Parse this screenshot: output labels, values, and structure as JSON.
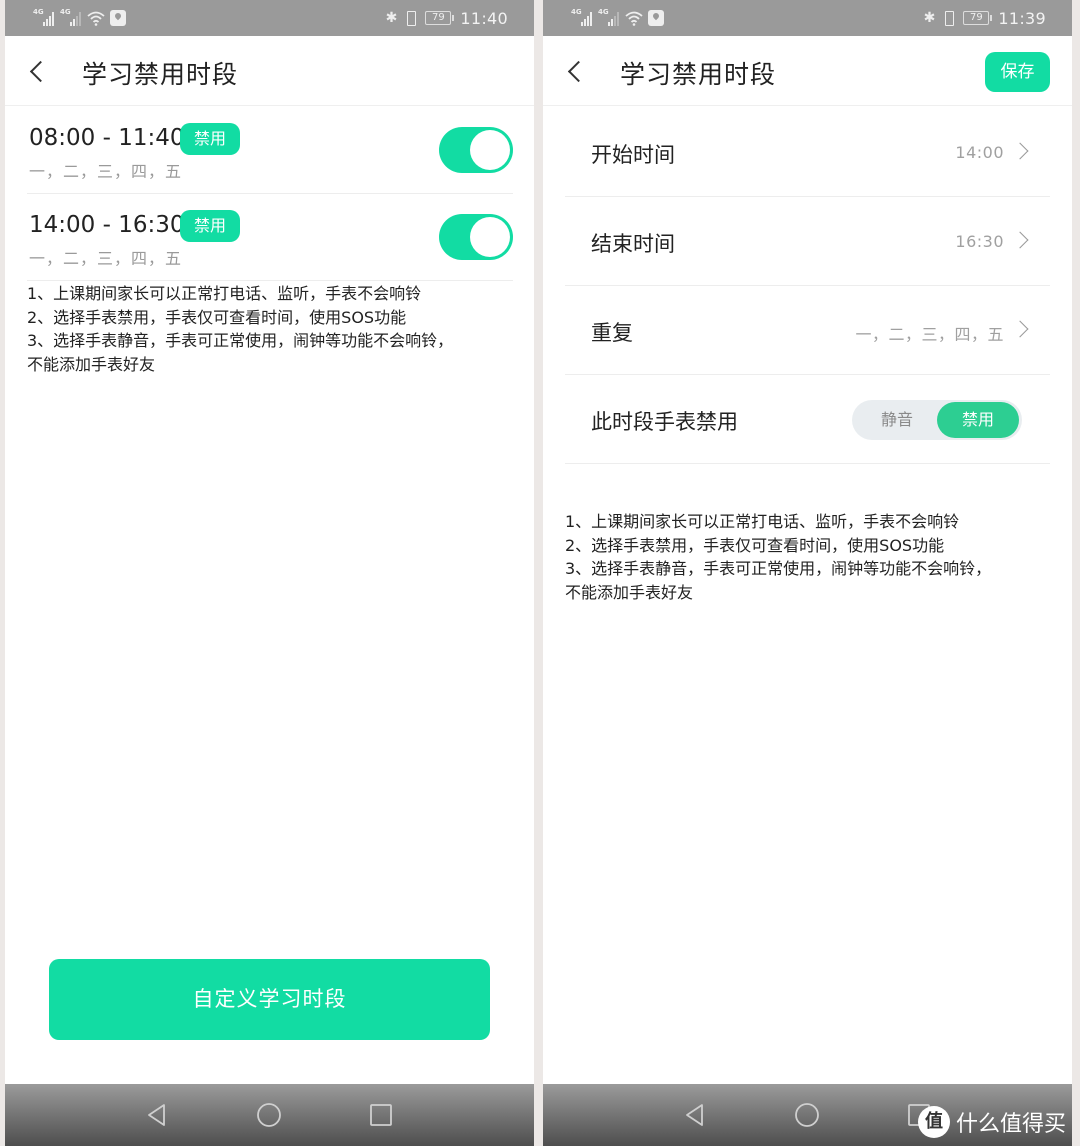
{
  "colors": {
    "accent": "#12dca3",
    "segment_on": "#2dce92",
    "statusbar": "#9a9a9a"
  },
  "left_screen": {
    "statusbar": {
      "network1": "4G",
      "network2": "4G",
      "battery": "79",
      "time": "11:40"
    },
    "header": {
      "title": "学习禁用时段",
      "back_icon": "chevron-left-icon"
    },
    "slots": [
      {
        "time": "08:00 - 11:40",
        "badge": "禁用",
        "days": "一，二，三，四，五",
        "enabled": true
      },
      {
        "time": "14:00 - 16:30",
        "badge": "禁用",
        "days": "一，二，三，四，五",
        "enabled": true
      }
    ],
    "notes": [
      "1、上课期间家长可以正常打电话、监听，手表不会响铃",
      "2、选择手表禁用，手表仅可查看时间，使用SOS功能",
      "3、选择手表静音，手表可正常使用，闹钟等功能不会响铃，",
      "不能添加手表好友"
    ],
    "custom_button": "自定义学习时段"
  },
  "right_screen": {
    "statusbar": {
      "network1": "4G",
      "network2": "4G",
      "battery": "79",
      "time": "11:39"
    },
    "header": {
      "title": "学习禁用时段",
      "save_label": "保存"
    },
    "rows": [
      {
        "label": "开始时间",
        "value": "14:00"
      },
      {
        "label": "结束时间",
        "value": "16:30"
      },
      {
        "label": "重复",
        "value": "一，二，三，四，五"
      }
    ],
    "mode_row": {
      "label": "此时段手表禁用",
      "options": [
        "静音",
        "禁用"
      ],
      "selected": "禁用"
    },
    "notes": [
      "1、上课期间家长可以正常打电话、监听，手表不会响铃",
      "2、选择手表禁用，手表仅可查看时间，使用SOS功能",
      "3、选择手表静音，手表可正常使用，闹钟等功能不会响铃，",
      "不能添加手表好友"
    ],
    "watermark": {
      "logo": "值",
      "text": "什么值得买"
    }
  }
}
